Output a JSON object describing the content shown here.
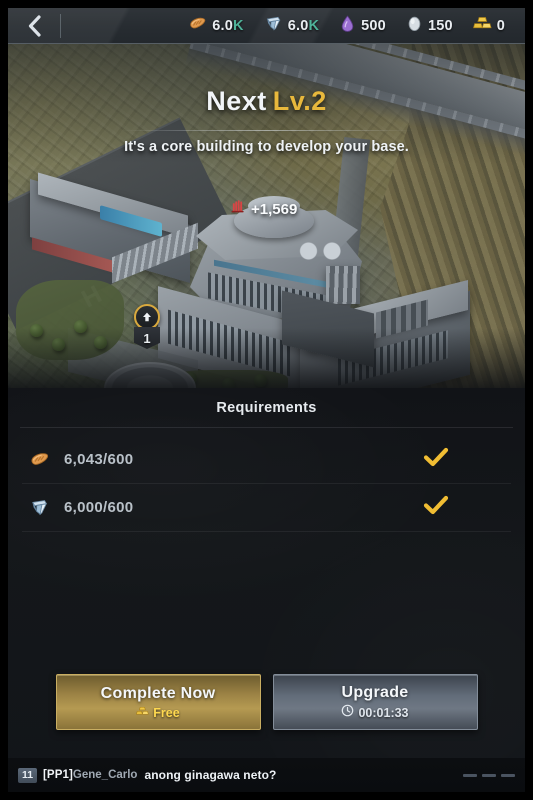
{
  "topbar": {
    "back_icon": "chevron-left-icon",
    "resources": [
      {
        "id": "bread",
        "icon": "bread-icon",
        "value": "6.0K",
        "suffix": "K",
        "number": "6.0"
      },
      {
        "id": "steel",
        "icon": "steel-icon",
        "value": "6.0K",
        "suffix": "K",
        "number": "6.0"
      },
      {
        "id": "oil",
        "icon": "oil-drop-icon",
        "value": "500",
        "suffix": "",
        "number": "500"
      },
      {
        "id": "silver",
        "icon": "silver-icon",
        "value": "150",
        "suffix": "",
        "number": "150"
      },
      {
        "id": "gold",
        "icon": "gold-bars-icon",
        "value": "0",
        "suffix": "",
        "number": "0"
      }
    ]
  },
  "hero": {
    "next_label": "Next",
    "level_label": "Lv.2",
    "description": "It's a core building to develop your base.",
    "power_icon": "power-up-icon",
    "power_gain": "+1,569",
    "current_level": "1",
    "level_badge_icon": "arrow-up-circle-icon"
  },
  "requirements": {
    "title": "Requirements",
    "rows": [
      {
        "icon": "bread-icon",
        "amount": "6,043/600",
        "status_icon": "check-icon",
        "met": true
      },
      {
        "icon": "steel-icon",
        "amount": "6,000/600",
        "status_icon": "check-icon",
        "met": true
      }
    ]
  },
  "actions": {
    "complete": {
      "label": "Complete Now",
      "cost_icon": "gold-bars-icon",
      "cost": "Free"
    },
    "upgrade": {
      "label": "Upgrade",
      "time_icon": "clock-icon",
      "time": "00:01:33"
    }
  },
  "chat": {
    "badge": "11",
    "guild_tag": "[PP1]",
    "username": "Gene_Carlo",
    "message": "anong ginagawa neto?",
    "collapse_icon": "collapse-lines-icon"
  },
  "colors": {
    "accent_gold": "#e8b83c",
    "check_gold": "#f0bd33",
    "resource_k_green": "#4fb39a",
    "panel_bg": "#14171a",
    "free_yellow": "#ffd94f"
  }
}
